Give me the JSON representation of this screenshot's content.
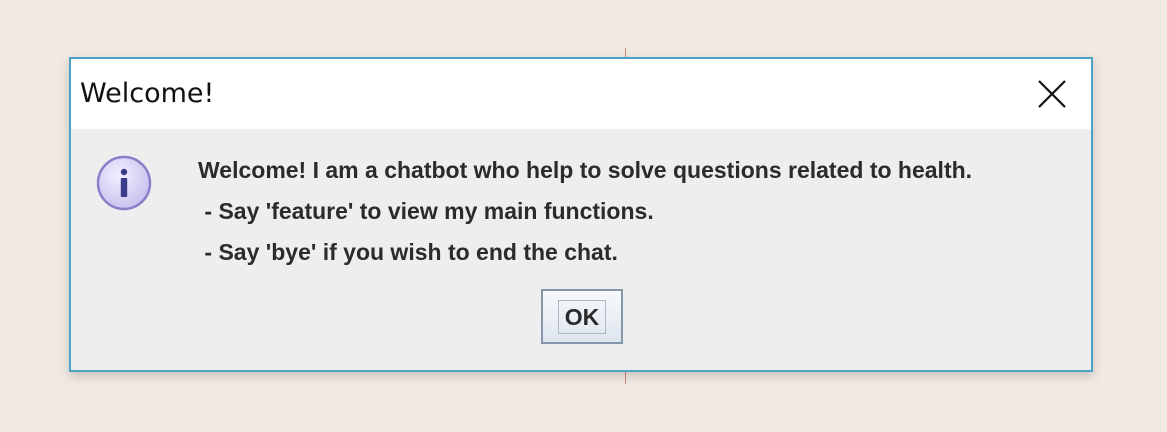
{
  "dialog": {
    "title": "Welcome!",
    "close_icon": "close-icon",
    "message_icon": "info-icon",
    "message_lines": [
      "Welcome! I am a chatbot who help to solve questions related to health.",
      " - Say 'feature' to view my main functions.",
      " - Say 'bye' if you wish to end the chat."
    ],
    "ok_label": "OK"
  },
  "colors": {
    "background": "#f1e9e2",
    "dialog_border": "#4aa3c4",
    "dialog_body": "#eeeeee",
    "titlebar": "#ffffff",
    "info_icon_fill": "#d8d2f4",
    "info_icon_stroke": "#8880c8"
  }
}
